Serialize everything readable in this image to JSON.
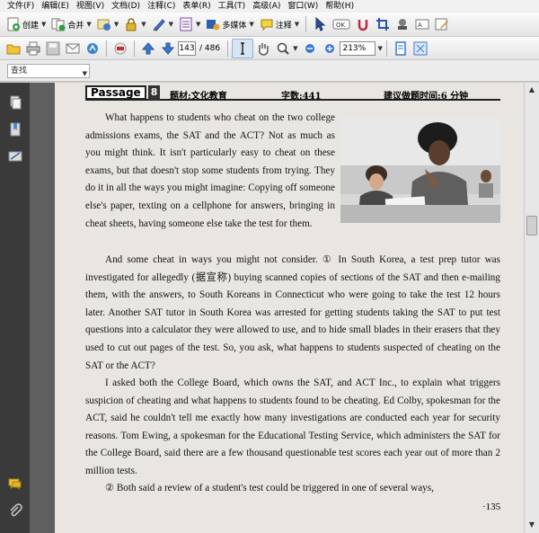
{
  "menu": [
    "文件(F)",
    "编辑(E)",
    "视图(V)",
    "文档(D)",
    "注释(C)",
    "表单(R)",
    "工具(T)",
    "高级(A)",
    "窗口(W)",
    "帮助(H)"
  ],
  "toolbar1": {
    "create_label": "创建",
    "combine_label": "合并",
    "multimedia_label": "多媒体",
    "comment_label": "注释"
  },
  "toolbar2": {
    "current_page": "143",
    "total_pages": "/ 486",
    "zoom": "213%"
  },
  "search": {
    "placeholder": "查找"
  },
  "document": {
    "passage_label": "Passage",
    "passage_number": "8",
    "topic": "题材:文化教育",
    "word_count": "字数:441",
    "suggested_time": "建议做题时间:6 分钟",
    "para1": "What happens to students who cheat on the two college admissions exams, the SAT and the ACT? Not as much as you might think. It isn't particularly easy to cheat on these exams, but that doesn't stop some students from trying. They do it in all the ways you might imagine: Copying off someone else's paper, texting on a cellphone for answers, bringing in cheat sheets, having someone else take the test for them.",
    "para2": "And some cheat in ways you might not consider. ① In South Korea, a test prep tutor was investigated for allegedly (据宣称) buying scanned copies of sections of the SAT and then e-mailing them, with the answers, to South Koreans in Connecticut who were going to take the test 12 hours later. Another SAT tutor in South Korea was arrested for getting students taking the SAT to put test questions into a calculator they were allowed to use, and to hide small blades in their erasers that they used to cut out pages of the test. So, you ask, what happens to students suspected of cheating on the SAT or the ACT?",
    "para3": "I asked both the College Board, which owns the SAT, and ACT Inc., to explain what triggers suspicion of cheating and what happens to students found to be cheating. Ed Colby, spokesman for the ACT, said he couldn't tell me exactly how many investigations are conducted each year for security reasons. Tom Ewing, a spokesman for the Educational Testing Service, which administers the SAT for the College Board, said there are a few thousand questionable test scores each year out of more than 2 million tests.",
    "para4": "② Both said a review of a student's test could be triggered in one of several ways,",
    "page_number": "·135"
  },
  "colors": {
    "viewer_bg": "#5f5f5f",
    "page_bg": "#e9e6e2",
    "left_panel": "#3a3a3a"
  }
}
